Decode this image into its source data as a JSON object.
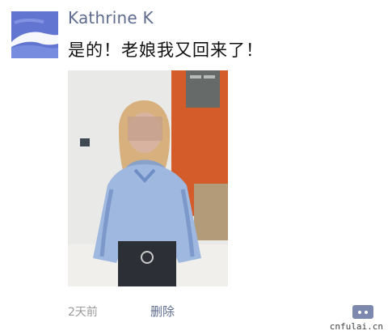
{
  "post": {
    "username": "Kathrine K",
    "text": "是的！老娘我又回来了！",
    "time": "2天前",
    "delete_label": "删除"
  },
  "icons": {
    "avatar": "avatar-image",
    "comment": "comment-bubble-icon"
  },
  "watermark": "cnfulai.cn",
  "colors": {
    "name_link": "#5f6c90",
    "text": "#111111",
    "meta": "#9a9a9a",
    "comment_button": "#7c88ad"
  }
}
